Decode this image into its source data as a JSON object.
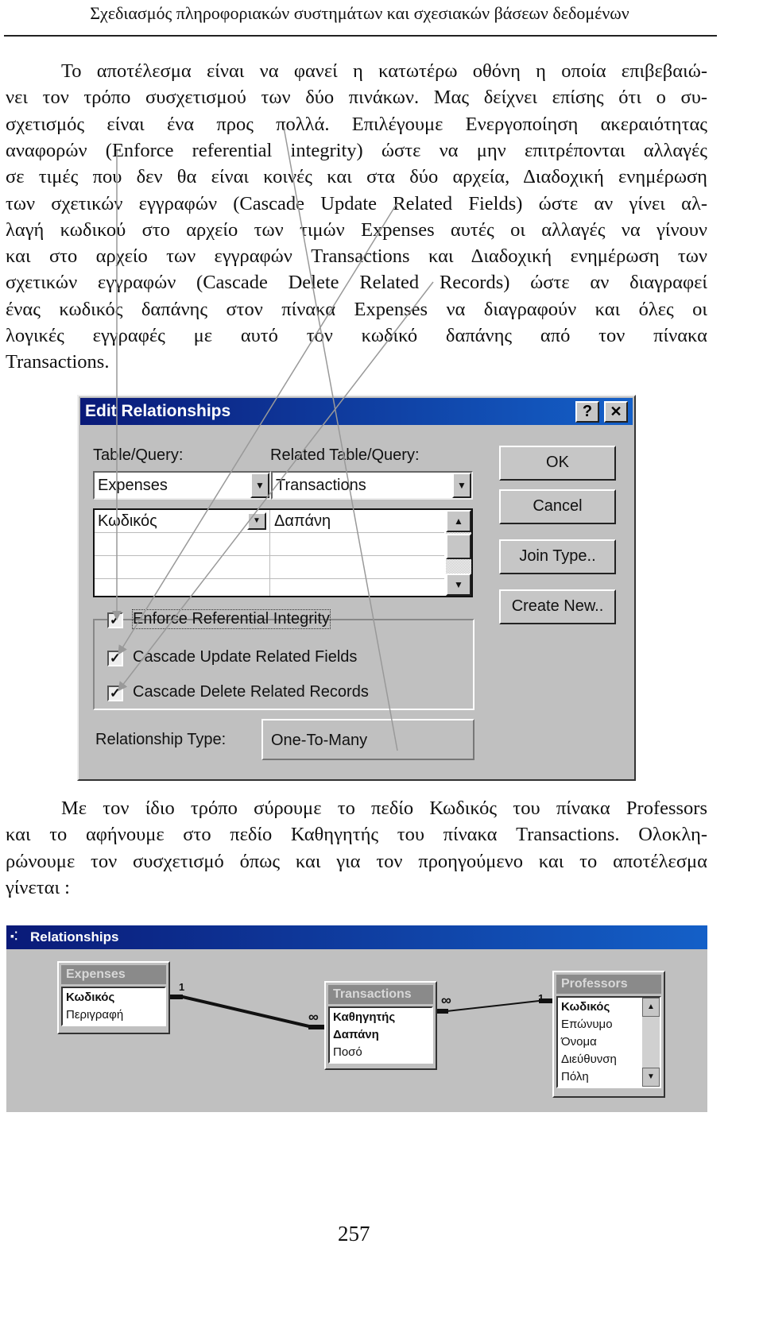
{
  "header": "Σχεδιασμός πληροφοριακών συστημάτων και σχεσιακών βάσεων δεδομένων",
  "paragraph1": [
    "Το αποτέλεσμα είναι να φανεί η κατωτέρω οθόνη η οποία επιβεβαιώ-",
    "νει τον τρόπο συσχετισμού των δύο πινάκων. Μας δείχνει επίσης ότι ο συ-",
    "σχετισμός είναι ένα προς πολλά. Επιλέγουμε Ενεργοποίηση ακεραιότητας",
    "αναφορών (Enforce referential integrity) ώστε να μην επιτρέπονται αλλαγές",
    "σε τιμές που δεν θα είναι κοινές και στα δύο αρχεία, Διαδοχική ενημέρωση",
    "των σχετικών εγγραφών (Cascade Update Related Fields) ώστε αν γίνει αλ-",
    "λαγή κωδικού στο αρχείο των τιμών Expenses αυτές οι αλλαγές να γίνουν",
    "και στο αρχείο των εγγραφών Transactions και Διαδοχική ενημέρωση των",
    "σχετικών εγγραφών (Cascade Delete Related Records) ώστε αν διαγραφεί",
    "ένας κωδικός δαπάνης στον πίνακα Expenses να διαγραφούν και όλες οι",
    "λογικές εγγραφές με αυτό τον κωδικό δαπάνης από τον πίνακα",
    "Transactions."
  ],
  "dialog": {
    "title": "Edit Relationships",
    "help": "?",
    "close": "✕",
    "table_label": "Table/Query:",
    "related_label": "Related Table/Query:",
    "table_value": "Expenses",
    "related_value": "Transactions",
    "field_left": "Κωδικός",
    "field_right": "Δαπάνη",
    "buttons": {
      "ok": "OK",
      "cancel": "Cancel",
      "join": "Join Type..",
      "create": "Create New.."
    },
    "checks": [
      {
        "label": "Enforce Referential Integrity",
        "checked": true
      },
      {
        "label": "Cascade Update Related Fields",
        "checked": true
      },
      {
        "label": "Cascade Delete Related Records",
        "checked": true
      }
    ],
    "type_label": "Relationship Type:",
    "type_value": "One-To-Many"
  },
  "paragraph2": [
    "Με τον ίδιο τρόπο σύρουμε το πεδίο Κωδικός του πίνακα Professors",
    "και το αφήνουμε στο πεδίο Καθηγητής του πίνακα Transactions. Ολοκλη-",
    "ρώνουμε τον συσχετισμό όπως και για τον προηγούμενο και το αποτέλεσμα",
    "γίνεται :"
  ],
  "relwin": {
    "title": "Relationships",
    "expenses": {
      "title": "Expenses",
      "fields": [
        "Κωδικός",
        "Περιγραφή"
      ]
    },
    "transactions": {
      "title": "Transactions",
      "fields": [
        "Καθηγητής",
        "Δαπάνη",
        "Ποσό"
      ]
    },
    "professors": {
      "title": "Professors",
      "fields": [
        "Κωδικός",
        "Επώνυμο",
        "Όνομα",
        "Διεύθυνση",
        "Πόλη"
      ]
    },
    "one": "1",
    "many": "∞"
  },
  "page_number": "257"
}
